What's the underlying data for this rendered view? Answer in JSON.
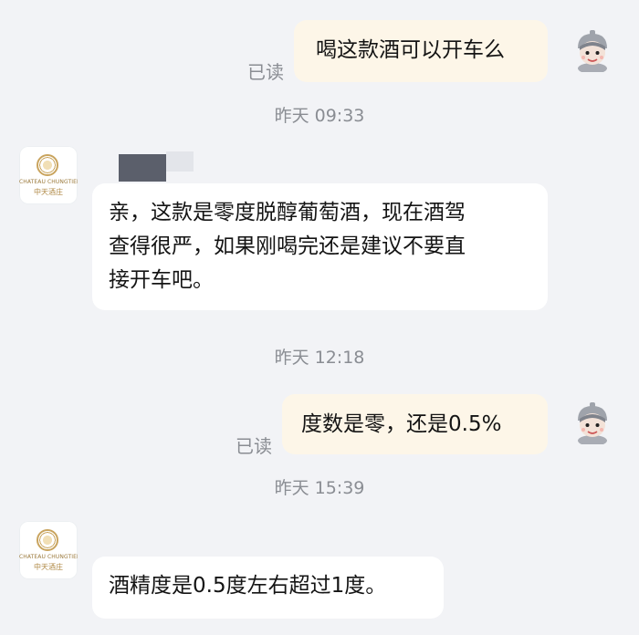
{
  "messages": [
    {
      "text": "喝这款酒可以开车么",
      "read": "已读"
    },
    {
      "time": "昨天 09:33"
    },
    {
      "text_lines": [
        "亲，这款是零度脱醇葡萄酒，现在酒驾",
        "查得很严，如果刚喝完还是建议不要直",
        "接开车吧。"
      ]
    },
    {
      "time": "昨天 12:18"
    },
    {
      "text": "度数是零，还是0.5%",
      "read": "已读"
    },
    {
      "time": "昨天 15:39"
    },
    {
      "text": "酒精度是0.5度左右超过1度。"
    }
  ],
  "shop_logo": {
    "line1": "CHATEAU CHUNGTIEN",
    "line2": "中天酒庄"
  },
  "colors": {
    "background": "#f2f3f6",
    "user_bubble": "#fdf6e8",
    "shop_bubble": "#ffffff",
    "secondary_text": "#8a8d93"
  },
  "icons": {
    "user_avatar": "cartoon-helmet-avatar-icon",
    "shop_avatar": "chateau-logo-icon"
  }
}
